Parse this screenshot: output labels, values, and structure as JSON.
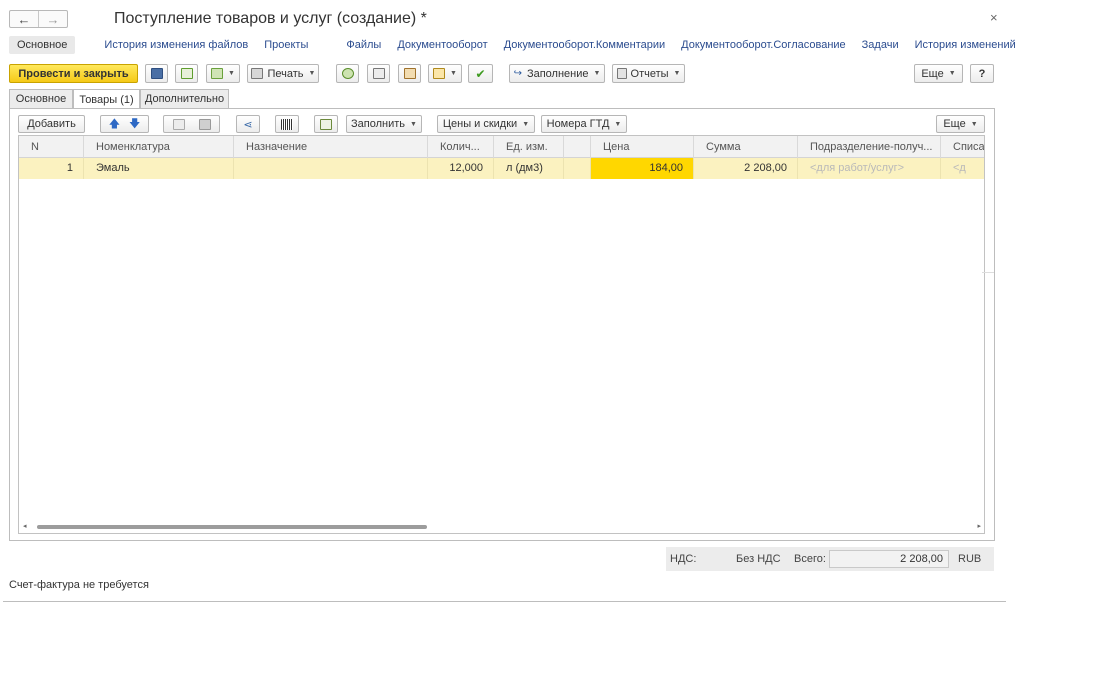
{
  "window": {
    "title": "Поступление товаров и услуг (создание) *",
    "back_icon": "←",
    "forward_icon": "→",
    "close_icon": "×"
  },
  "top_links": {
    "main": "Основное",
    "items": [
      "История изменения файлов",
      "Проекты",
      "Файлы",
      "Документооборот",
      "Документооборот.Комментарии",
      "Документооборот.Согласование",
      "Задачи",
      "История изменений"
    ]
  },
  "toolbar": {
    "post_close": "Провести и закрыть",
    "print": "Печать",
    "fill": "Заполнение",
    "reports": "Отчеты",
    "more": "Еще",
    "help": "?"
  },
  "tabs": [
    "Основное",
    "Товары (1)",
    "Дополнительно"
  ],
  "inner_toolbar": {
    "add": "Добавить",
    "fill": "Заполнить",
    "prices": "Цены и скидки",
    "gtd": "Номера ГТД",
    "more": "Еще"
  },
  "table": {
    "headers": [
      "N",
      "Номенклатура",
      "Назначение",
      "Колич...",
      "Ед. изм.",
      "",
      "Цена",
      "Сумма",
      "Подразделение-получ...",
      "Списат"
    ],
    "row": {
      "n": "1",
      "item": "Эмаль",
      "purpose": "",
      "qty": "12,000",
      "unit": "л (дм3)",
      "price": "184,00",
      "sum": "2 208,00",
      "dept": "<для работ/услуг>",
      "writeoff": "<д"
    }
  },
  "totals": {
    "vat_label": "НДС:",
    "vat_value": "Без НДС",
    "total_label": "Всего:",
    "total_value": "2 208,00",
    "currency": "RUB"
  },
  "footer": {
    "invoice_note": "Счет-фактура не требуется"
  },
  "colors": {
    "accent_yellow": "#f5c918",
    "selected_cell": "#ffd700",
    "row_highlight": "#fbf2c0",
    "link": "#2b4c8f"
  }
}
